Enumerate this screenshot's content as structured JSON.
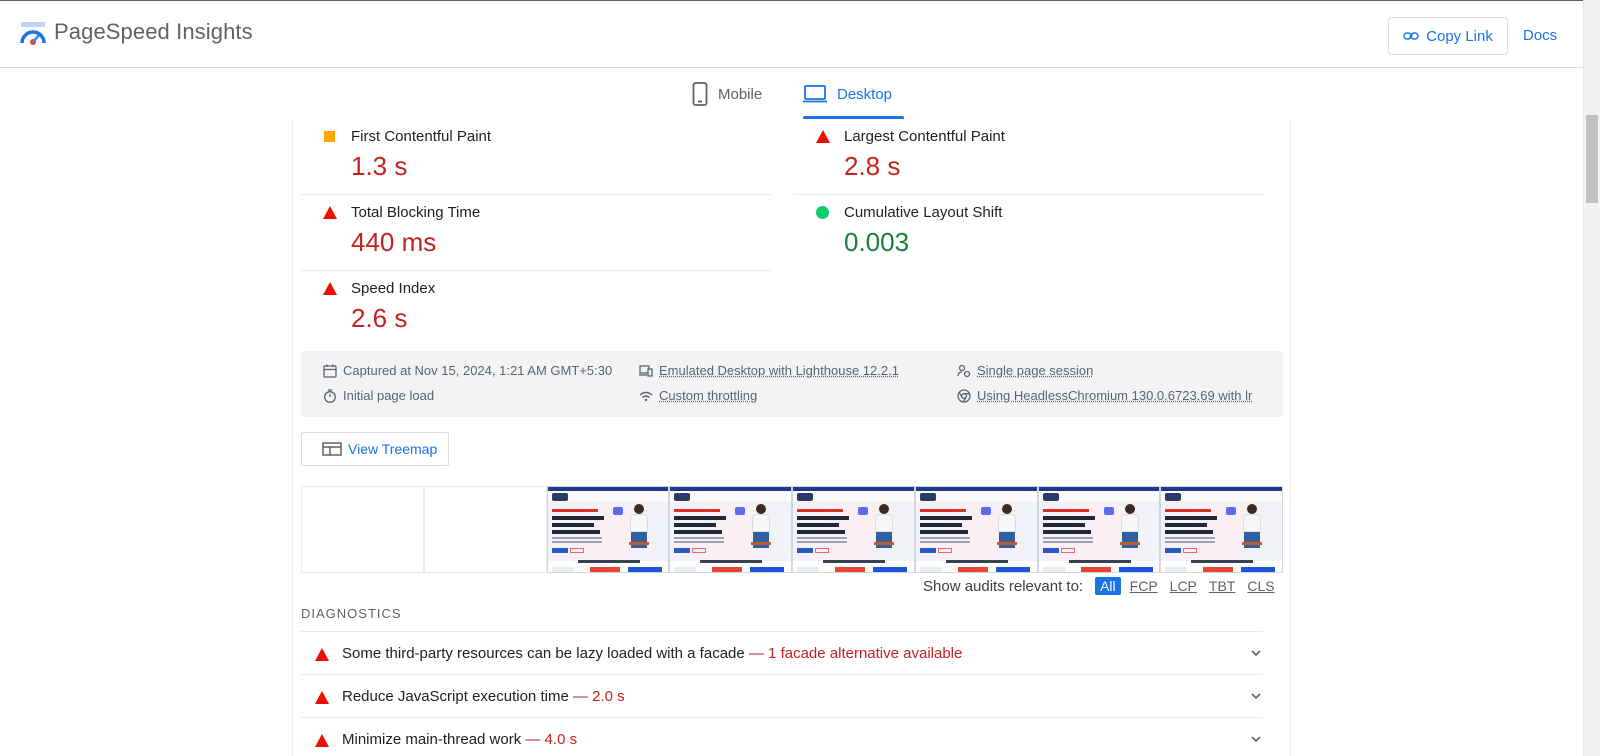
{
  "header": {
    "brand": "PageSpeed Insights",
    "copy_link_label": "Copy Link",
    "docs_label": "Docs"
  },
  "tabs": [
    {
      "label": "Mobile",
      "icon": "smartphone-icon",
      "active": false
    },
    {
      "label": "Desktop",
      "icon": "laptop-icon",
      "active": true
    }
  ],
  "metrics": [
    {
      "label": "First Contentful Paint",
      "value": "1.3 s",
      "status": "average",
      "icon": "orange-square-icon"
    },
    {
      "label": "Largest Contentful Paint",
      "value": "2.8 s",
      "status": "fail",
      "icon": "red-triangle-icon"
    },
    {
      "label": "Total Blocking Time",
      "value": "440 ms",
      "status": "fail",
      "icon": "red-triangle-icon"
    },
    {
      "label": "Cumulative Layout Shift",
      "value": "0.003",
      "status": "pass",
      "icon": "green-circle-icon"
    },
    {
      "label": "Speed Index",
      "value": "2.6 s",
      "status": "fail",
      "icon": "red-triangle-icon"
    }
  ],
  "runtime": {
    "captured": "Captured at Nov 15, 2024, 1:21 AM GMT+5:30",
    "load": "Initial page load",
    "emulated": "Emulated Desktop with Lighthouse 12.2.1",
    "throttling": "Custom throttling",
    "session": "Single page session",
    "browser": "Using HeadlessChromium 130.0.6723.69 with lr"
  },
  "treemap_label": "View Treemap",
  "filter": {
    "label": "Show audits relevant to:",
    "options": [
      "All",
      "FCP",
      "LCP",
      "TBT",
      "CLS"
    ],
    "active": "All"
  },
  "diagnostics": {
    "title": "DIAGNOSTICS",
    "items": [
      {
        "title": "Some third-party resources can be lazy loaded with a facade",
        "display": "— 1 facade alternative available"
      },
      {
        "title": "Reduce JavaScript execution time",
        "display": "— 2.0 s"
      },
      {
        "title": "Minimize main-thread work",
        "display": "— 4.0 s"
      }
    ]
  },
  "colors": {
    "accent": "#1a73e8",
    "fail": "#c5221f",
    "pass": "#188038",
    "average": "#ffa400"
  }
}
